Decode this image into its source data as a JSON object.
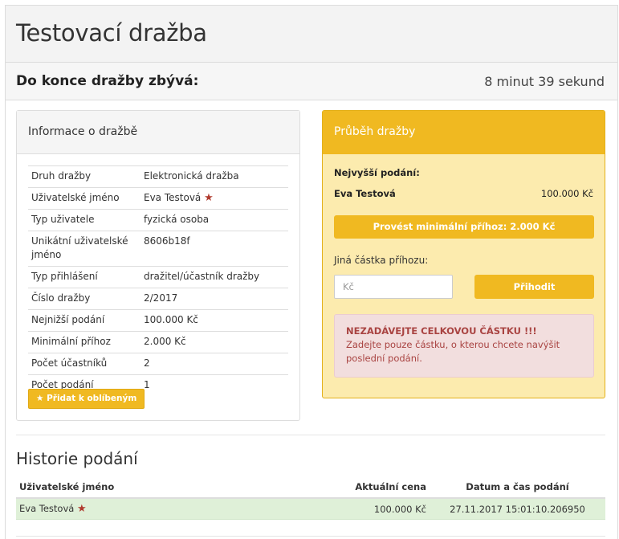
{
  "page": {
    "title": "Testovací dražba"
  },
  "countdown": {
    "label": "Do konce dražby zbývá:",
    "value": "8 minut 39 sekund"
  },
  "info": {
    "heading": "Informace o dražbě",
    "rows": [
      {
        "key": "Druh dražby",
        "value": "Elektronická dražba"
      },
      {
        "key": "Uživatelské jméno",
        "value": "Eva Testová"
      },
      {
        "key": "Typ uživatele",
        "value": "fyzická osoba"
      },
      {
        "key": "Unikátní uživatelské jméno",
        "value": "8606b18f"
      },
      {
        "key": "Typ přihlášení",
        "value": "dražitel/účastník dražby"
      },
      {
        "key": "Číslo dražby",
        "value": "2/2017"
      },
      {
        "key": "Nejnižší podání",
        "value": "100.000 Kč"
      },
      {
        "key": "Minimální příhoz",
        "value": "2.000 Kč"
      },
      {
        "key": "Počet účastníků",
        "value": "2"
      },
      {
        "key": "Počet podání",
        "value": "1"
      }
    ],
    "favorite_button": "Přidat k oblíbeným"
  },
  "progress": {
    "heading": "Průběh dražby",
    "highest_bid_label": "Nejvyšší podání:",
    "highest_bid_user": "Eva Testová",
    "highest_bid_amount": "100.000 Kč",
    "min_bid_button": "Provést minimální příhoz: 2.000 Kč",
    "other_amount_label": "Jiná částka příhozu:",
    "amount_placeholder": "Kč",
    "bid_button": "Přihodit",
    "warning_title": "NEZADÁVEJTE CELKOVOU ČÁSTKU !!!",
    "warning_text": "Zadejte pouze částku, o kterou chcete navýšit poslední podání."
  },
  "history": {
    "title": "Historie podání",
    "columns": [
      "Uživatelské jméno",
      "Aktuální cena",
      "Datum a čas podání"
    ],
    "rows": [
      {
        "user": "Eva Testová",
        "price": "100.000 Kč",
        "datetime": "27.11.2017 15:01:10.206950"
      }
    ]
  },
  "colors": {
    "accent": "#f0b921",
    "panel_bg": "#fcebae",
    "warning_bg": "#f2dede",
    "warning_text": "#a94442",
    "row_highlight": "#dff0d8",
    "star": "#b03a2e"
  },
  "icons": [
    "star-icon"
  ]
}
